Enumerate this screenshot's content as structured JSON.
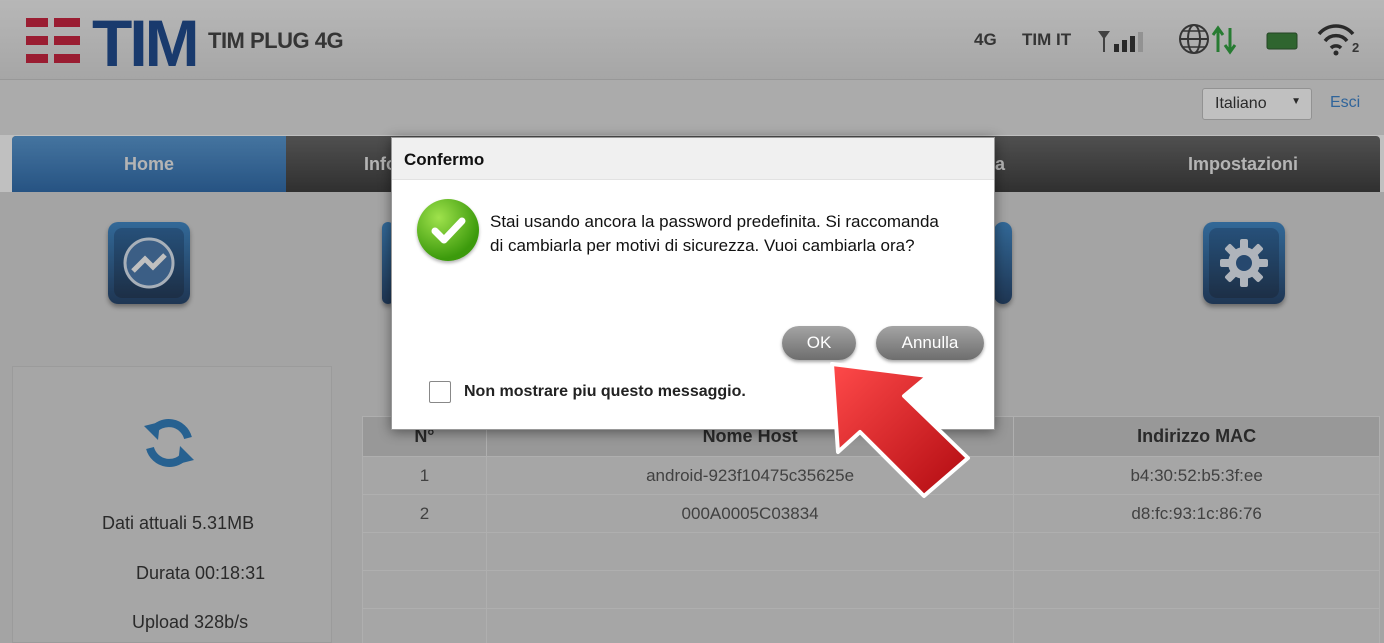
{
  "header": {
    "brand": "TIM",
    "product": "TIM PLUG 4G",
    "network_type": "4G",
    "operator": "TIM IT",
    "wifi_clients": "2",
    "brand_colors": {
      "red": "#c8102e",
      "blue": "#0a3a85"
    }
  },
  "toolbar": {
    "language": "Italiano",
    "logout": "Esci"
  },
  "nav": {
    "tabs": [
      {
        "label": "Home",
        "active": true
      },
      {
        "label": "Info",
        "active": false
      },
      {
        "label": "a",
        "active": false
      },
      {
        "label": "Impostazioni",
        "active": false
      }
    ]
  },
  "stats": {
    "data": "Dati attuali 5.31MB",
    "duration": "Durata 00:18:31",
    "upload": "Upload 328b/s"
  },
  "hosts_table": {
    "headers": [
      "N°",
      "Nome Host",
      "Indirizzo MAC"
    ],
    "rows": [
      [
        "1",
        "android-923f10475c35625e",
        "b4:30:52:b5:3f:ee"
      ],
      [
        "2",
        "000A0005C03834",
        "d8:fc:93:1c:86:76"
      ],
      [
        "",
        "",
        ""
      ],
      [
        "",
        "",
        ""
      ],
      [
        "",
        "",
        ""
      ]
    ]
  },
  "dialog": {
    "title": "Confermo",
    "message": "Stai usando ancora la password predefinita. Si raccomanda di cambiarla per motivi di sicurezza. Vuoi cambiarla ora?",
    "ok_label": "OK",
    "cancel_label": "Annulla",
    "dont_show_label": "Non mostrare piu questo messaggio.",
    "dont_show_checked": false
  },
  "annotation": {
    "icon": "red-pointer-arrow",
    "color": "#d8141a"
  }
}
